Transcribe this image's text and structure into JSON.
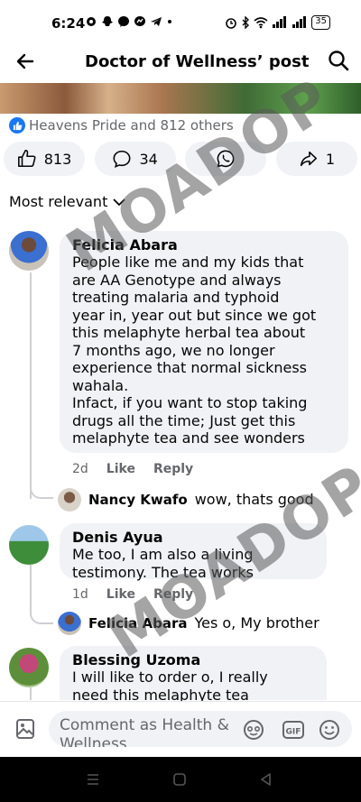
{
  "status_bar": {
    "time": "6:24",
    "notification_icons": [
      "settings-icon",
      "snapchat-icon",
      "messenger-icon",
      "messenger-icon",
      "telegram-icon",
      "dot-icon"
    ],
    "battery": "35"
  },
  "header": {
    "title": "Doctor of Wellness’ post"
  },
  "reactions": {
    "summary": "Heavens Pride and 812 others"
  },
  "actions": {
    "like_count": "813",
    "comment_count": "34",
    "share_count": "1"
  },
  "sort": {
    "label": "Most relevant"
  },
  "comments": [
    {
      "author": "Felicia Abara",
      "text_lines": [
        "People like me and my kids that",
        "are AA Genotype and always",
        "treating malaria and typhoid",
        "year in, year out but since we got",
        "this melaphyte herbal tea about",
        "7 months ago, we no longer",
        "experience that normal sickness",
        "wahala.",
        "Infact, if you want to stop taking",
        "drugs all the time; Just get this",
        "melaphyte tea and see wonders"
      ],
      "age": "2d",
      "like_label": "Like",
      "reply_label": "Reply",
      "reply": {
        "author": "Nancy Kwafo",
        "text": "wow, thats good"
      }
    },
    {
      "author": "Denis Ayua",
      "text_lines": [
        "Me too, I am also a living",
        "testimony. The tea works"
      ],
      "age": "1d",
      "like_label": "Like",
      "reply_label": "Reply",
      "reply": {
        "author": "Felicia Abara",
        "text": "Yes o, My brother"
      }
    },
    {
      "author": "Blessing Uzoma",
      "text_lines": [
        "I will like to order o, I really",
        "need this melaphyte tea"
      ]
    }
  ],
  "watermarks": [
    "MOADOP",
    "MOADOP"
  ],
  "composer": {
    "placeholder_line1": "Comment as Health &",
    "placeholder_line2": "Wellness"
  },
  "colors": {
    "accent": "#1877f2",
    "bubble": "#f0f2f5",
    "secondary_text": "#65676b",
    "watermark": "#5a5a5a"
  }
}
